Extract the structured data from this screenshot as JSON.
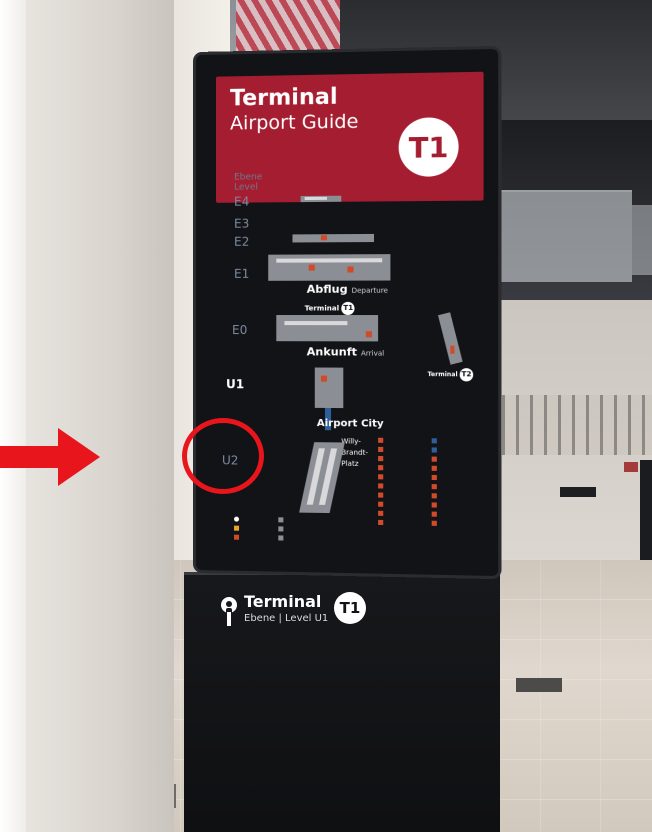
{
  "sign": {
    "header_title": "Terminal",
    "header_subtitle": "Airport Guide",
    "header_badge": "T1",
    "level_heading": "Ebene",
    "level_heading_en": "Level",
    "levels": [
      "E4",
      "E3",
      "E2",
      "E1",
      "E0",
      "U1",
      "U2"
    ],
    "departure_de": "Abflug",
    "departure_en": "Departure",
    "arrival_de": "Ankunft",
    "arrival_en": "Arrival",
    "terminal_label": "Terminal",
    "terminal_t1_badge": "T1",
    "terminal_t2_label": "Terminal",
    "terminal_t2_badge": "T2",
    "airport_city": "Airport City",
    "plaza": "Willy-\nBrandt-\nPlatz",
    "highlighted_level": "U2"
  },
  "pedestal": {
    "title": "Terminal",
    "level": "Ebene | Level U1",
    "badge": "T1"
  },
  "colors": {
    "brand_red": "#a51d31",
    "highlight_red": "#e8151c",
    "sign_background": "#121316"
  },
  "icons": [
    "location-pin-icon",
    "arrow-right-icon"
  ]
}
